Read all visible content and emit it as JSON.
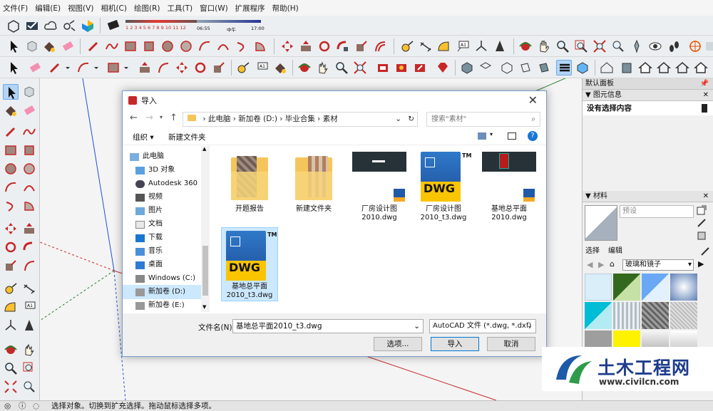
{
  "menu": [
    "文件(F)",
    "编辑(E)",
    "视图(V)",
    "相机(C)",
    "绘图(R)",
    "工具(T)",
    "窗口(W)",
    "扩展程序",
    "帮助(H)"
  ],
  "shadow_bar": {
    "numbers": "1 2 3 4 5 6 7 8 9 10 11 12",
    "time_start": "06:55",
    "time_mid": "中午",
    "time_end": "17:00"
  },
  "dialog": {
    "title": "导入",
    "path": [
      "此电脑",
      "新加卷 (D:)",
      "毕业合集",
      "素材"
    ],
    "search_placeholder": "搜索\"素材\"",
    "organize_label": "组织 ▾",
    "new_folder_label": "新建文件夹",
    "nav_items": [
      {
        "label": "此电脑",
        "icon": "computer-icon"
      },
      {
        "label": "3D 对象",
        "icon": "3d-objects-icon"
      },
      {
        "label": "Autodesk 360",
        "icon": "cloud-icon"
      },
      {
        "label": "视频",
        "icon": "video-icon"
      },
      {
        "label": "图片",
        "icon": "pictures-icon"
      },
      {
        "label": "文档",
        "icon": "documents-icon"
      },
      {
        "label": "下载",
        "icon": "download-icon"
      },
      {
        "label": "音乐",
        "icon": "music-icon"
      },
      {
        "label": "桌面",
        "icon": "desktop-icon"
      },
      {
        "label": "Windows (C:)",
        "icon": "windows-drive-icon"
      },
      {
        "label": "新加卷 (D:)",
        "icon": "drive-icon",
        "selected": true
      },
      {
        "label": "新加卷 (E:)",
        "icon": "drive-icon"
      }
    ],
    "files": [
      {
        "line1": "开题报告",
        "line2": "",
        "type": "folder"
      },
      {
        "line1": "新建文件夹",
        "line2": "",
        "type": "folder"
      },
      {
        "line1": "厂房设计图",
        "line2": "2010.dwg",
        "type": "dwg-preview"
      },
      {
        "line1": "厂房设计图",
        "line2": "2010_t3.dwg",
        "type": "dwg-icon"
      },
      {
        "line1": "基地总平面",
        "line2": "2010.dwg",
        "type": "dwg-preview-red"
      },
      {
        "line1": "基地总平面",
        "line2": "2010_t3.dwg",
        "type": "dwg-icon",
        "selected": true
      }
    ],
    "filename_label": "文件名(N):",
    "filename_value": "基地总平面2010_t3.dwg",
    "filetype_value": "AutoCAD 文件 (*.dwg, *.dxf)",
    "options_label": "选项...",
    "import_label": "导入",
    "cancel_label": "取消"
  },
  "right_panel": {
    "default_panel": "默认面板",
    "entity_info": "图元信息",
    "no_selection": "没有选择内容",
    "materials": "材料",
    "preset": "预设",
    "tab_select": "选择",
    "tab_edit": "编辑",
    "library": "玻璃和镜子"
  },
  "status_text": "选择对象。切换到扩充选择。拖动鼠标选择多项。",
  "watermark": {
    "name": "土木工程网",
    "url": "www.civilcn.com"
  }
}
